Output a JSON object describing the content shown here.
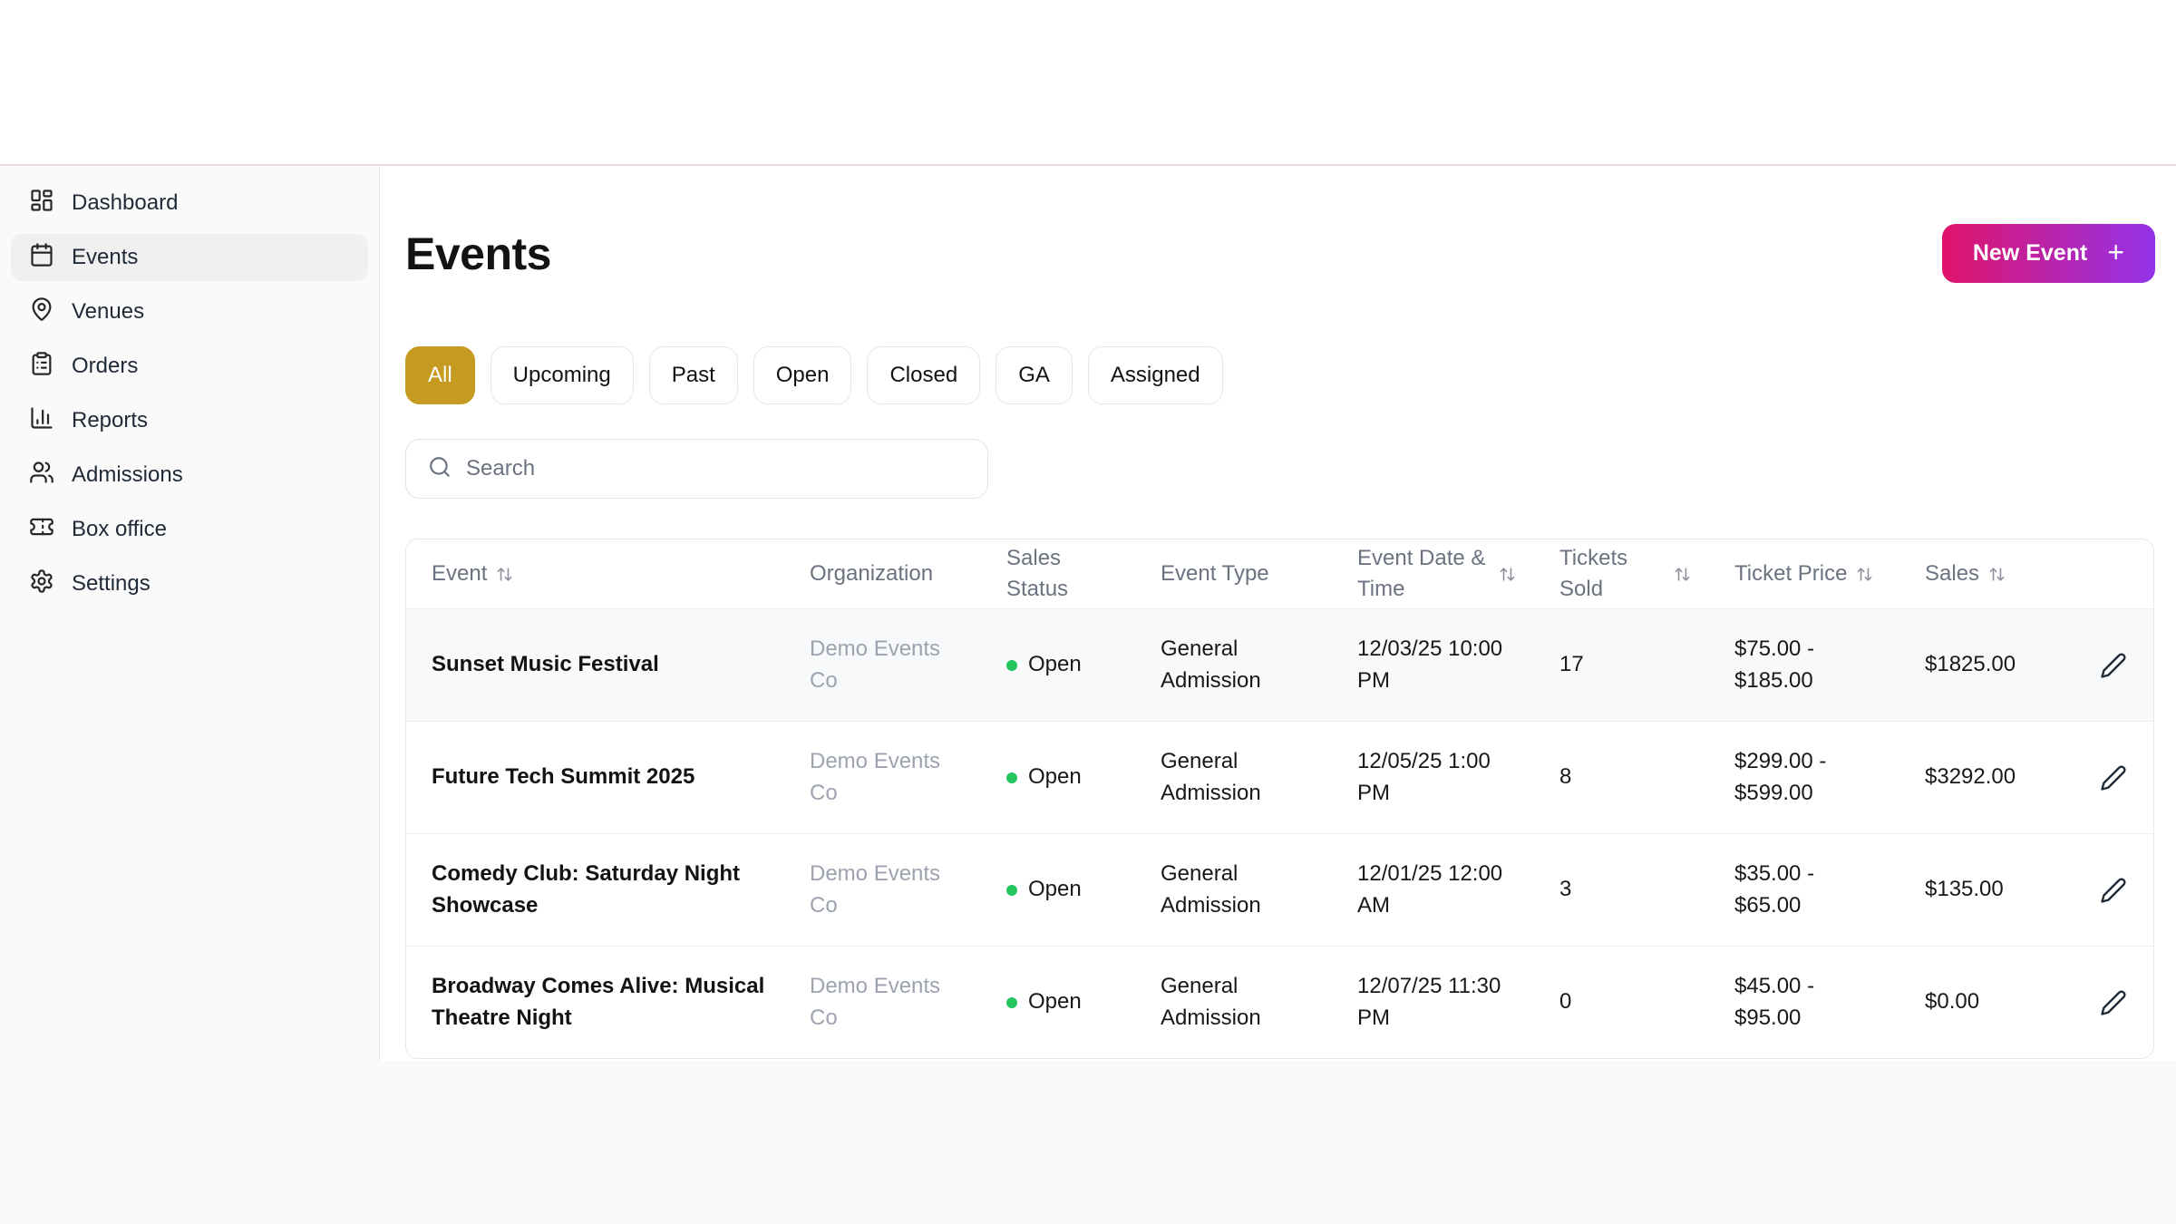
{
  "colors": {
    "accent_gold": "#c69b22",
    "button_gradient_from": "#e0146a",
    "button_gradient_to": "#9333ea",
    "open_status_dot": "#22c55e",
    "topbar_divider": "#f7d8d8"
  },
  "sidebar": {
    "items": [
      {
        "label": "Dashboard",
        "icon": "dashboard-grid-icon"
      },
      {
        "label": "Events",
        "icon": "calendar-icon"
      },
      {
        "label": "Venues",
        "icon": "map-pin-icon"
      },
      {
        "label": "Orders",
        "icon": "clipboard-list-icon"
      },
      {
        "label": "Reports",
        "icon": "bar-chart-icon"
      },
      {
        "label": "Admissions",
        "icon": "users-icon"
      },
      {
        "label": "Box office",
        "icon": "ticket-icon"
      },
      {
        "label": "Settings",
        "icon": "gear-icon"
      }
    ],
    "active_item": "Events"
  },
  "page": {
    "title": "Events"
  },
  "actions": {
    "new_event_label": "New Event",
    "plus_glyph": "+"
  },
  "filters": {
    "items": [
      {
        "label": "All",
        "active": true
      },
      {
        "label": "Upcoming",
        "active": false
      },
      {
        "label": "Past",
        "active": false
      },
      {
        "label": "Open",
        "active": false
      },
      {
        "label": "Closed",
        "active": false
      },
      {
        "label": "GA",
        "active": false
      },
      {
        "label": "Assigned",
        "active": false
      }
    ]
  },
  "search": {
    "placeholder": "Search",
    "value": ""
  },
  "table": {
    "columns": [
      {
        "label": "Event",
        "sortable": true
      },
      {
        "label": "Organization",
        "sortable": false
      },
      {
        "label": "Sales Status",
        "sortable": false
      },
      {
        "label": "Event Type",
        "sortable": false
      },
      {
        "label": "Event Date & Time",
        "sortable": true
      },
      {
        "label": "Tickets Sold",
        "sortable": true
      },
      {
        "label": "Ticket Price",
        "sortable": true
      },
      {
        "label": "Sales",
        "sortable": true
      }
    ],
    "rows": [
      {
        "event": "Sunset Music Festival",
        "organization": "Demo Events Co",
        "sales_status": "Open",
        "event_type": "General Admission",
        "datetime": "12/03/25 10:00 PM",
        "tickets_sold": "17",
        "ticket_price": "$75.00 - $185.00",
        "sales": "$1825.00"
      },
      {
        "event": "Future Tech Summit 2025",
        "organization": "Demo Events Co",
        "sales_status": "Open",
        "event_type": "General Admission",
        "datetime": "12/05/25 1:00 PM",
        "tickets_sold": "8",
        "ticket_price": "$299.00 - $599.00",
        "sales": "$3292.00"
      },
      {
        "event": "Comedy Club: Saturday Night Showcase",
        "organization": "Demo Events Co",
        "sales_status": "Open",
        "event_type": "General Admission",
        "datetime": "12/01/25 12:00 AM",
        "tickets_sold": "3",
        "ticket_price": "$35.00 - $65.00",
        "sales": "$135.00"
      },
      {
        "event": "Broadway Comes Alive: Musical Theatre Night",
        "organization": "Demo Events Co",
        "sales_status": "Open",
        "event_type": "General Admission",
        "datetime": "12/07/25 11:30 PM",
        "tickets_sold": "0",
        "ticket_price": "$45.00 - $95.00",
        "sales": "$0.00"
      }
    ]
  }
}
